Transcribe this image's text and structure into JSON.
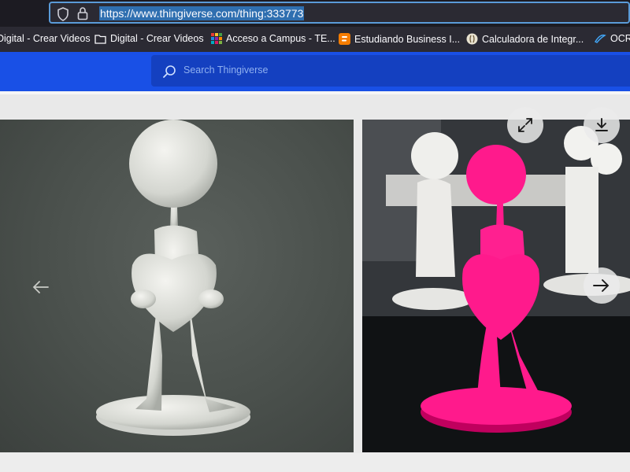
{
  "browser": {
    "url": "https://www.thingiverse.com/thing:333773",
    "bookmarks": [
      {
        "label": "Digital - Crear Videos",
        "icon": "folder-icon"
      },
      {
        "label": "Digital - Crear Videos",
        "icon": "folder-icon"
      },
      {
        "label": "Acceso a Campus - TE...",
        "icon": "colorful-grid-icon"
      },
      {
        "label": "Estudiando Business I...",
        "icon": "blogger-icon"
      },
      {
        "label": "Calculadora de Integr...",
        "icon": "site-favicon-icon"
      },
      {
        "label": "OCR",
        "icon": "ocr-favicon-icon"
      }
    ]
  },
  "header": {
    "search_placeholder": "Search Thingiverse",
    "accent": "#1950e6"
  },
  "gallery": {
    "controls": [
      "prev-arrow-icon",
      "fullscreen-icon",
      "download-icon",
      "next-arrow-icon"
    ]
  }
}
